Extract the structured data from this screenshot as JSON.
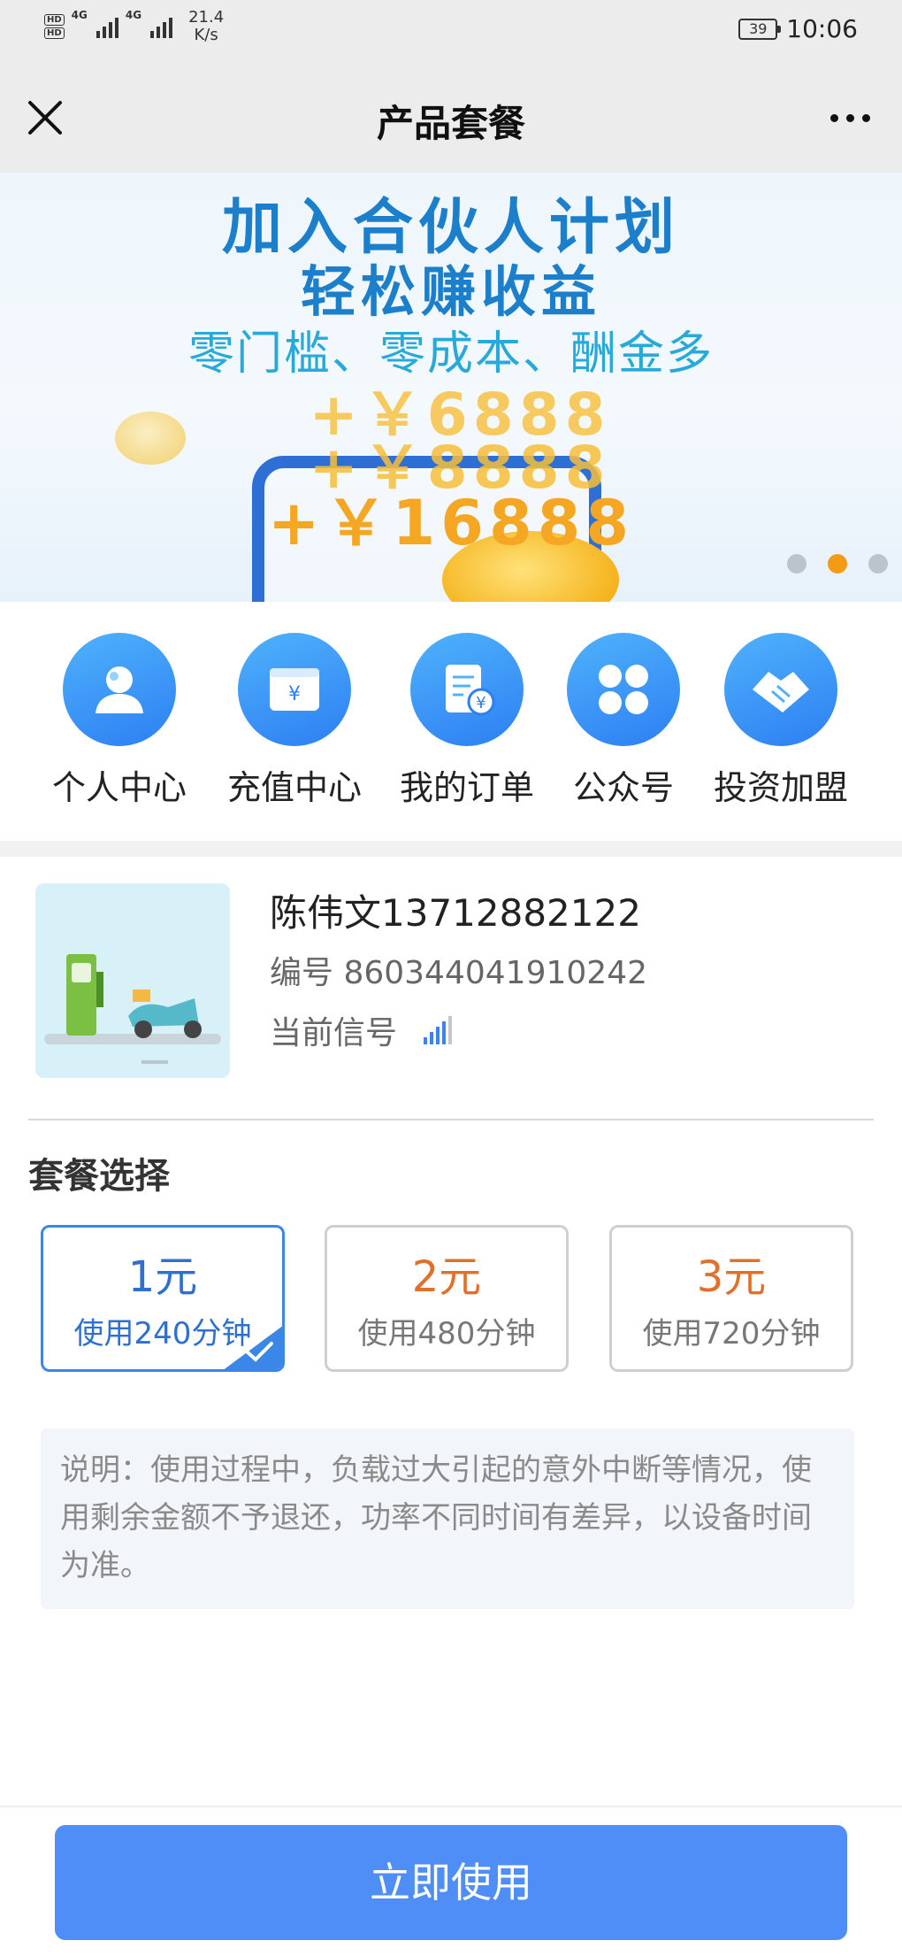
{
  "status_bar": {
    "hd1": "HD",
    "hd2": "HD",
    "net1": "4G",
    "net2": "4G",
    "speed_value": "21.4",
    "speed_unit": "K/s",
    "battery": "39",
    "time": "10:06"
  },
  "nav": {
    "title": "产品套餐",
    "close_icon": "close-icon",
    "more_icon": "more-icon"
  },
  "banner": {
    "line1": "加入合伙人计划",
    "line2": "轻松赚收益",
    "line3": "零门槛、零成本、酬金多",
    "amount1": "+￥6888",
    "amount2": "+￥8888",
    "amount3": "+￥16888",
    "active_slide": 2,
    "slide_count": 3
  },
  "quick_links": [
    {
      "label": "个人中心",
      "icon": "person-icon"
    },
    {
      "label": "充值中心",
      "icon": "recharge-icon"
    },
    {
      "label": "我的订单",
      "icon": "order-icon"
    },
    {
      "label": "公众号",
      "icon": "grid-icon"
    },
    {
      "label": "投资加盟",
      "icon": "handshake-icon"
    }
  ],
  "device": {
    "name": "陈伟文13712882122",
    "id": "编号 860344041910242",
    "signal_label": "当前信号",
    "signal_level_of_5": 4
  },
  "packages": {
    "title": "套餐选择",
    "items": [
      {
        "price": "1元",
        "duration": "使用240分钟",
        "selected": true
      },
      {
        "price": "2元",
        "duration": "使用480分钟",
        "selected": false
      },
      {
        "price": "3元",
        "duration": "使用720分钟",
        "selected": false
      }
    ]
  },
  "note": {
    "text": "说明：使用过程中，负载过大引起的意外中断等情况，使用剩余金额不予退还，功率不同时间有差异，以设备时间为准。"
  },
  "action": {
    "use_now": "立即使用"
  },
  "colors": {
    "accent": "#4f8ef7",
    "selected_border": "#3b87e8",
    "price_orange": "#e0702a",
    "banner_title": "#1b7fcb",
    "dot_active": "#f59a14"
  }
}
